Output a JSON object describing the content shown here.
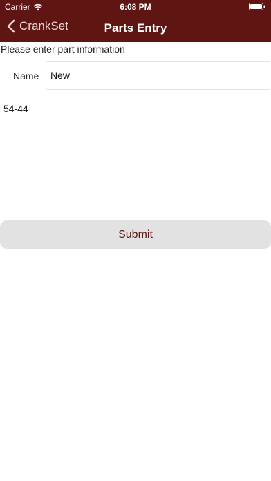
{
  "status_bar": {
    "carrier": "Carrier",
    "time": "6:08 PM",
    "wifi_icon": "wifi-icon",
    "battery_icon": "battery-icon"
  },
  "nav": {
    "back_label": "CrankSet",
    "back_icon": "chevron-left-icon",
    "title": "Parts Entry"
  },
  "form": {
    "instructions": "Please enter part information",
    "name_label": "Name",
    "name_value": "New",
    "part_number": "54-44",
    "submit_label": "Submit"
  },
  "colors": {
    "brand": "#5f1512",
    "button_bg": "#e2e2e2"
  }
}
